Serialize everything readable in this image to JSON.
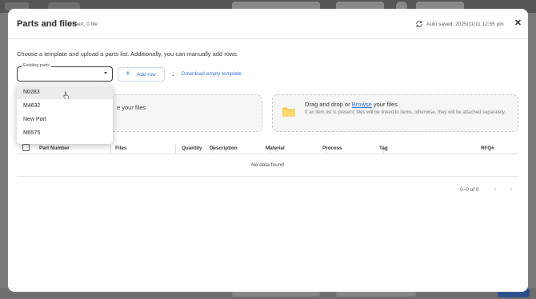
{
  "background": {
    "accent": "#2b4f8c"
  },
  "modal": {
    "title": "Parts and files",
    "subtitle": "0 part, 0 file",
    "autosave": "Auto saved, 2025/11/11 12:55 pm",
    "close_icon": "close-icon",
    "sync_icon": "sync-icon"
  },
  "instructions": "Choose a template and upload a parts list. Additionally, you can manually add rows.",
  "existing_parts": {
    "label": "Existing parts",
    "value": "",
    "options": [
      "N0283",
      "M4632",
      "New Part",
      "M6575"
    ],
    "hovered": "N0283"
  },
  "actions": {
    "add_row": "Add row",
    "download_template": "Download empty template"
  },
  "dropzone_left": {
    "text": "e your files"
  },
  "dropzone_right": {
    "prefix": "Drag and drop or ",
    "browse": "Browse",
    "suffix": " your files",
    "hint": "If an item list is present, files will be linked to items, otherwise, they will be attached separately."
  },
  "table": {
    "columns": [
      "Part Number",
      "Files",
      "Quantity",
      "Description",
      "Material",
      "Process",
      "Tag",
      "RFQ#"
    ],
    "empty_text": "No data found"
  },
  "pagination": {
    "range": "0–0 of 0"
  },
  "colors": {
    "link": "#2c6fd1",
    "folder": "#f2c94c"
  }
}
